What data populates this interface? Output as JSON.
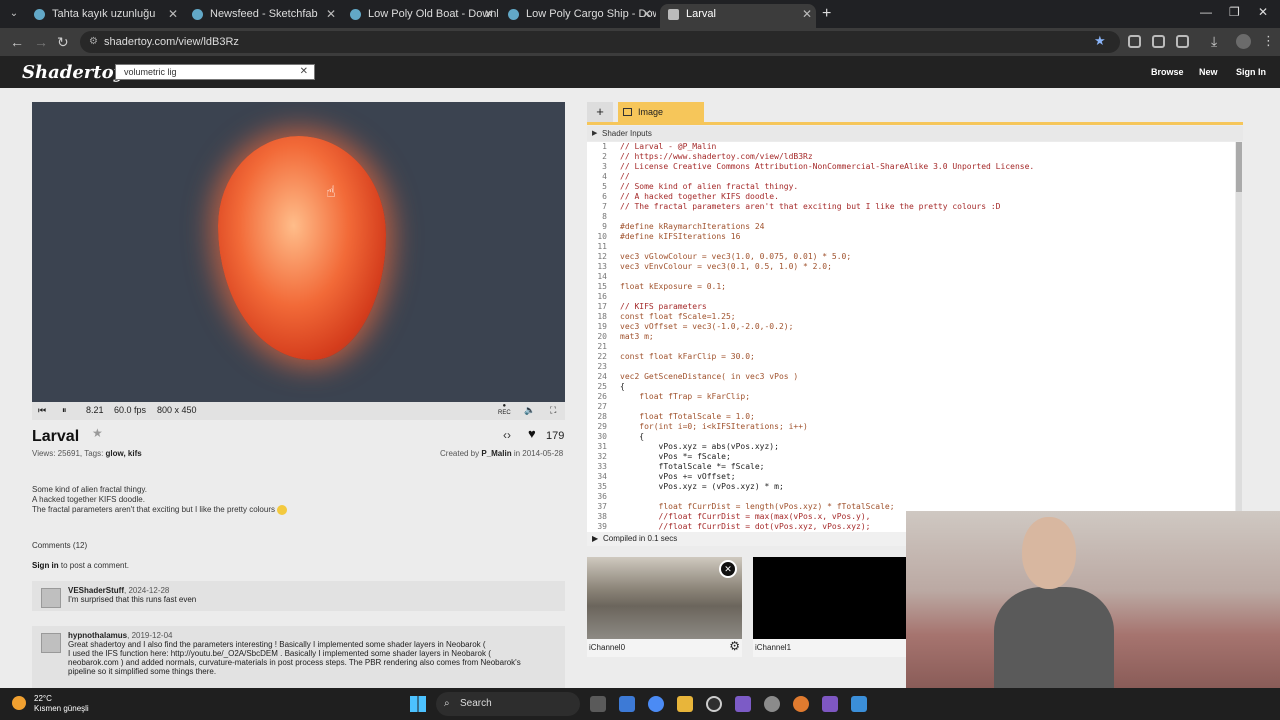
{
  "browser": {
    "tabs": [
      {
        "label": "Tahta kayık uzunluğu"
      },
      {
        "label": "Newsfeed - Sketchfab"
      },
      {
        "label": "Low Poly Old Boat - Download"
      },
      {
        "label": "Low Poly Cargo Ship - Downlo"
      },
      {
        "label": "Larval"
      }
    ],
    "url": "shadertoy.com/view/ldB3Rz"
  },
  "header": {
    "logo": "Shadertoy",
    "search_value": "volumetric lig",
    "links": {
      "browse": "Browse",
      "new": "New",
      "signin": "Sign In"
    }
  },
  "player": {
    "time": "8.21",
    "fps": "60.0 fps",
    "resolution": "800 x 450",
    "rec_label": "REC"
  },
  "shader": {
    "title": "Larval",
    "likes": "179",
    "views": "Views: 25691, Tags: ",
    "tags": "glow, kifs",
    "created_prefix": "Created by ",
    "author": "P_Malin",
    "created_suffix": " in 2014-05-28",
    "description": [
      "Some kind of alien fractal thingy.",
      "A hacked together KIFS doodle.",
      "The fractal parameters aren't that exciting but I like the pretty colours"
    ]
  },
  "comments": {
    "heading": "Comments (12)",
    "signin_link": "Sign in",
    "signin_rest": " to post a comment.",
    "items": [
      {
        "user": "VEShaderStuff",
        "date": ", 2024-12-28",
        "text": [
          "I'm surprised that this runs fast even"
        ]
      },
      {
        "user": "hypnothalamus",
        "date": ", 2019-12-04",
        "text": [
          "Great shadertoy and I also find the parameters interesting ! Basically I implemented some shader layers in Neobarok (",
          "neobarok.com ) and added normals, curvature-materials in post process steps. The PBR rendering also comes from Neobarok's",
          "pipeline so it simplified some things there."
        ]
      }
    ],
    "hidden_line": "I used the IFS function here: http://youtu.be/_O2A/SbcDEM . Basically I implemented some shader layers in Neobarok ("
  },
  "editor": {
    "add_tab": "+",
    "active_tab": "Image",
    "shader_inputs": "Shader Inputs",
    "compiled": "Compiled in 0.1 secs",
    "code": [
      {
        "n": "1",
        "t": "// Larval - @P_Malin"
      },
      {
        "n": "2",
        "t": "// https://www.shadertoy.com/view/ldB3Rz"
      },
      {
        "n": "3",
        "t": "// License Creative Commons Attribution-NonCommercial-ShareAlike 3.0 Unported License."
      },
      {
        "n": "4",
        "t": "//"
      },
      {
        "n": "5",
        "t": "// Some kind of alien fractal thingy."
      },
      {
        "n": "6",
        "t": "// A hacked together KIFS doodle."
      },
      {
        "n": "7",
        "t": "// The fractal parameters aren't that exciting but I like the pretty colours :D"
      },
      {
        "n": "8",
        "t": ""
      },
      {
        "n": "9",
        "t": "#define kRaymarchIterations 24"
      },
      {
        "n": "10",
        "t": "#define kIFSIterations 16"
      },
      {
        "n": "11",
        "t": ""
      },
      {
        "n": "12",
        "t": "vec3 vGlowColour = vec3(1.0, 0.075, 0.01) * 5.0;"
      },
      {
        "n": "13",
        "t": "vec3 vEnvColour = vec3(0.1, 0.5, 1.0) * 2.0;"
      },
      {
        "n": "14",
        "t": ""
      },
      {
        "n": "15",
        "t": "float kExposure = 0.1;"
      },
      {
        "n": "16",
        "t": ""
      },
      {
        "n": "17",
        "t": "// KIFS parameters"
      },
      {
        "n": "18",
        "t": "const float fScale=1.25;"
      },
      {
        "n": "19",
        "t": "vec3 vOffset = vec3(-1.0,-2.0,-0.2);"
      },
      {
        "n": "20",
        "t": "mat3 m;"
      },
      {
        "n": "21",
        "t": ""
      },
      {
        "n": "22",
        "t": "const float kFarClip = 30.0;"
      },
      {
        "n": "23",
        "t": ""
      },
      {
        "n": "24",
        "t": "vec2 GetSceneDistance( in vec3 vPos )"
      },
      {
        "n": "25",
        "t": "{"
      },
      {
        "n": "26",
        "t": "    float fTrap = kFarClip;"
      },
      {
        "n": "27",
        "t": ""
      },
      {
        "n": "28",
        "t": "    float fTotalScale = 1.0;"
      },
      {
        "n": "29",
        "t": "    for(int i=0; i<kIFSIterations; i++)"
      },
      {
        "n": "30",
        "t": "    {"
      },
      {
        "n": "31",
        "t": "        vPos.xyz = abs(vPos.xyz);"
      },
      {
        "n": "32",
        "t": "        vPos *= fScale;"
      },
      {
        "n": "33",
        "t": "        fTotalScale *= fScale;"
      },
      {
        "n": "34",
        "t": "        vPos += vOffset;"
      },
      {
        "n": "35",
        "t": "        vPos.xyz = (vPos.xyz) * m;"
      },
      {
        "n": "36",
        "t": ""
      },
      {
        "n": "37",
        "t": "        float fCurrDist = length(vPos.xyz) * fTotalScale;"
      },
      {
        "n": "38",
        "t": "        //float fCurrDist = max(max(vPos.x, vPos.y),"
      },
      {
        "n": "39",
        "t": "        //float fCurrDist = dot(vPos.xyz, vPos.xyz);"
      }
    ]
  },
  "channels": [
    {
      "label": "iChannel0"
    },
    {
      "label": "iChannel1"
    }
  ],
  "taskbar": {
    "temperature": "22°C",
    "weather": "Kısmen güneşli",
    "search": "Search"
  }
}
